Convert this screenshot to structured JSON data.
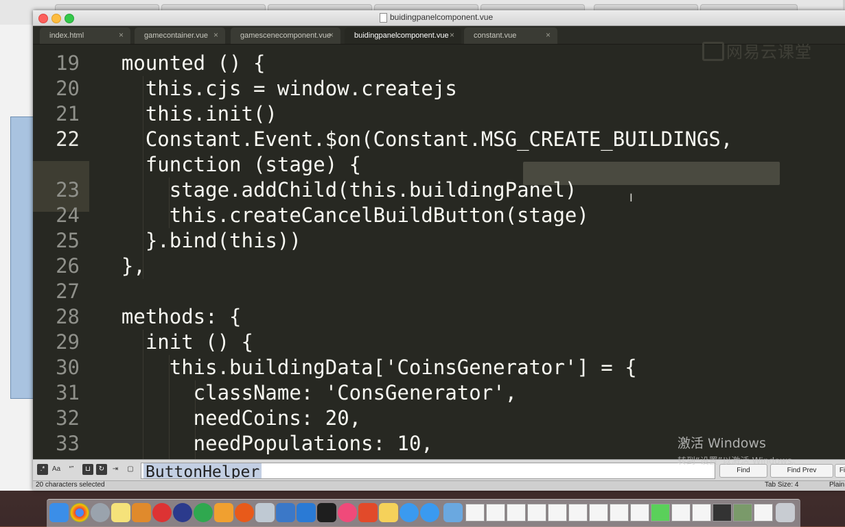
{
  "window": {
    "title": "buidingpanelcomponent.vue"
  },
  "tabs": [
    {
      "label": "index.html",
      "close": "×"
    },
    {
      "label": "gamecontainer.vue",
      "close": "×"
    },
    {
      "label": "gamescenecomponent.vue",
      "close": "×"
    },
    {
      "label": "buidingpanelcomponent.vue",
      "close": "×",
      "active": true
    },
    {
      "label": "constant.vue",
      "close": "×"
    }
  ],
  "gutter": {
    "lines": [
      "19",
      "20",
      "21",
      "22",
      "",
      "23",
      "24",
      "25",
      "26",
      "27",
      "28",
      "29",
      "30",
      "31",
      "32",
      "33"
    ]
  },
  "code": {
    "lines": [
      "  mounted () {",
      "    this.cjs = window.createjs",
      "    this.init()",
      "    Constant.Event.$on(Constant.MSG_CREATE_BUILDINGS,",
      "    function (stage) {",
      "      stage.addChild(this.buildingPanel)",
      "      this.createCancelBuildButton(stage)",
      "    }.bind(this))",
      "  },",
      "",
      "  methods: {",
      "    init () {",
      "      this.buildingData['CoinsGenerator'] = {",
      "        className: 'ConsGenerator',",
      "        needCoins: 20,",
      "        needPopulations: 10,"
    ],
    "selected_text": "MSG_CREATE_BUILDINGS"
  },
  "watermark": "网易云课堂",
  "find_panel": {
    "options": [
      ".*",
      "Aa",
      "“”",
      "⊔",
      "↻",
      "⇥",
      "▢"
    ],
    "query": "ButtonHelper",
    "find_label": "Find",
    "find_prev_label": "Find Prev",
    "find_all_label": "Fi"
  },
  "activation": {
    "title": "激活 Windows",
    "subtitle": "转到“设置”以激活 Windows。"
  },
  "status_bar": {
    "selection": "20 characters selected",
    "tab_size": "Tab Size: 4",
    "syntax": "Plain"
  },
  "colors": {
    "editor_bg": "#272822",
    "foreground": "#f8f8f2",
    "line_number": "#8f908a",
    "selection": "#4a4a40"
  }
}
